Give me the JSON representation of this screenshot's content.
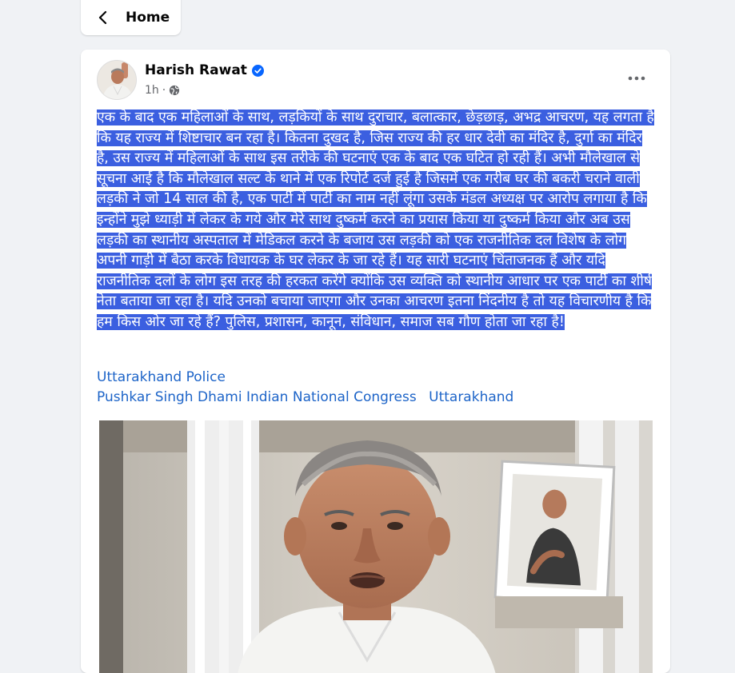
{
  "nav": {
    "back_label": "Home"
  },
  "post": {
    "author": "Harish Rawat",
    "time": "1h",
    "dot": "·",
    "more_icon": "more-horizontal-icon",
    "visibility_icon": "globe-icon",
    "verified_icon": "verified-badge-icon",
    "text": "एक के बाद एक महिलाओं के साथ, लड़कियों के साथ दुराचार, बलात्कार, छेड़छाड़, अभद्र आचरण, यह लगता है कि यह राज्य में शिष्टाचार बन रहा है। कितना दुखद है, जिस राज्य की हर धार देवी का मंदिर है, दुर्गा का मंदिर है, उस राज्य में महिलाओं के साथ इस तरीके की घटनाएं एक के बाद एक घटित हो रही हैं। अभी मौलेखाल से सूचना आई है कि मौलेखाल सल्ट के थाने में एक रिपोर्ट दर्ज हुई है जिसमें एक गरीब घर की बकरी चराने वाली लड़की ने जो 14 साल की है, एक पार्टी में पार्टी का नाम नहीं लूंगा उसके मंडल अध्यक्ष पर आरोप लगाया है कि इन्होंने मुझे ध्याड़ी में लेकर के गये और मेरे साथ दुष्कर्म करने का प्रयास किया या दुष्कर्म किया और अब उस लड़की का स्थानीय अस्पताल में मेडिकल करने के बजाय उस लड़की को एक राजनीतिक दल विशेष के लोग अपनी गाड़ी में बैठा करके विधायक के घर लेकर के जा रहे हैं। यह सारी घटनाएं चिंताजनक हैं और यदि राजनीतिक दलों के लोग इस तरह की हरकत करेंगे क्योंकि उस व्यक्ति को स्थानीय आधार पर एक पार्टी का शीर्ष नेता बताया जा रहा है। यदि उनको बचाया जाएगा और उनका आचरण इतना निंदनीय है तो यह विचारणीय है कि हम किस ओर जा रहे हैं? पुलिस, प्रशासन, कानून, संविधान, समाज सब गौण होता जा रहा है!",
    "tags": [
      "Uttarakhand Police",
      "Pushkar Singh Dhami",
      "Indian National Congress",
      "Uttarakhand"
    ]
  },
  "colors": {
    "selection": "#3b5fe0",
    "link": "#1d64c8",
    "verified": "#0866ff"
  }
}
